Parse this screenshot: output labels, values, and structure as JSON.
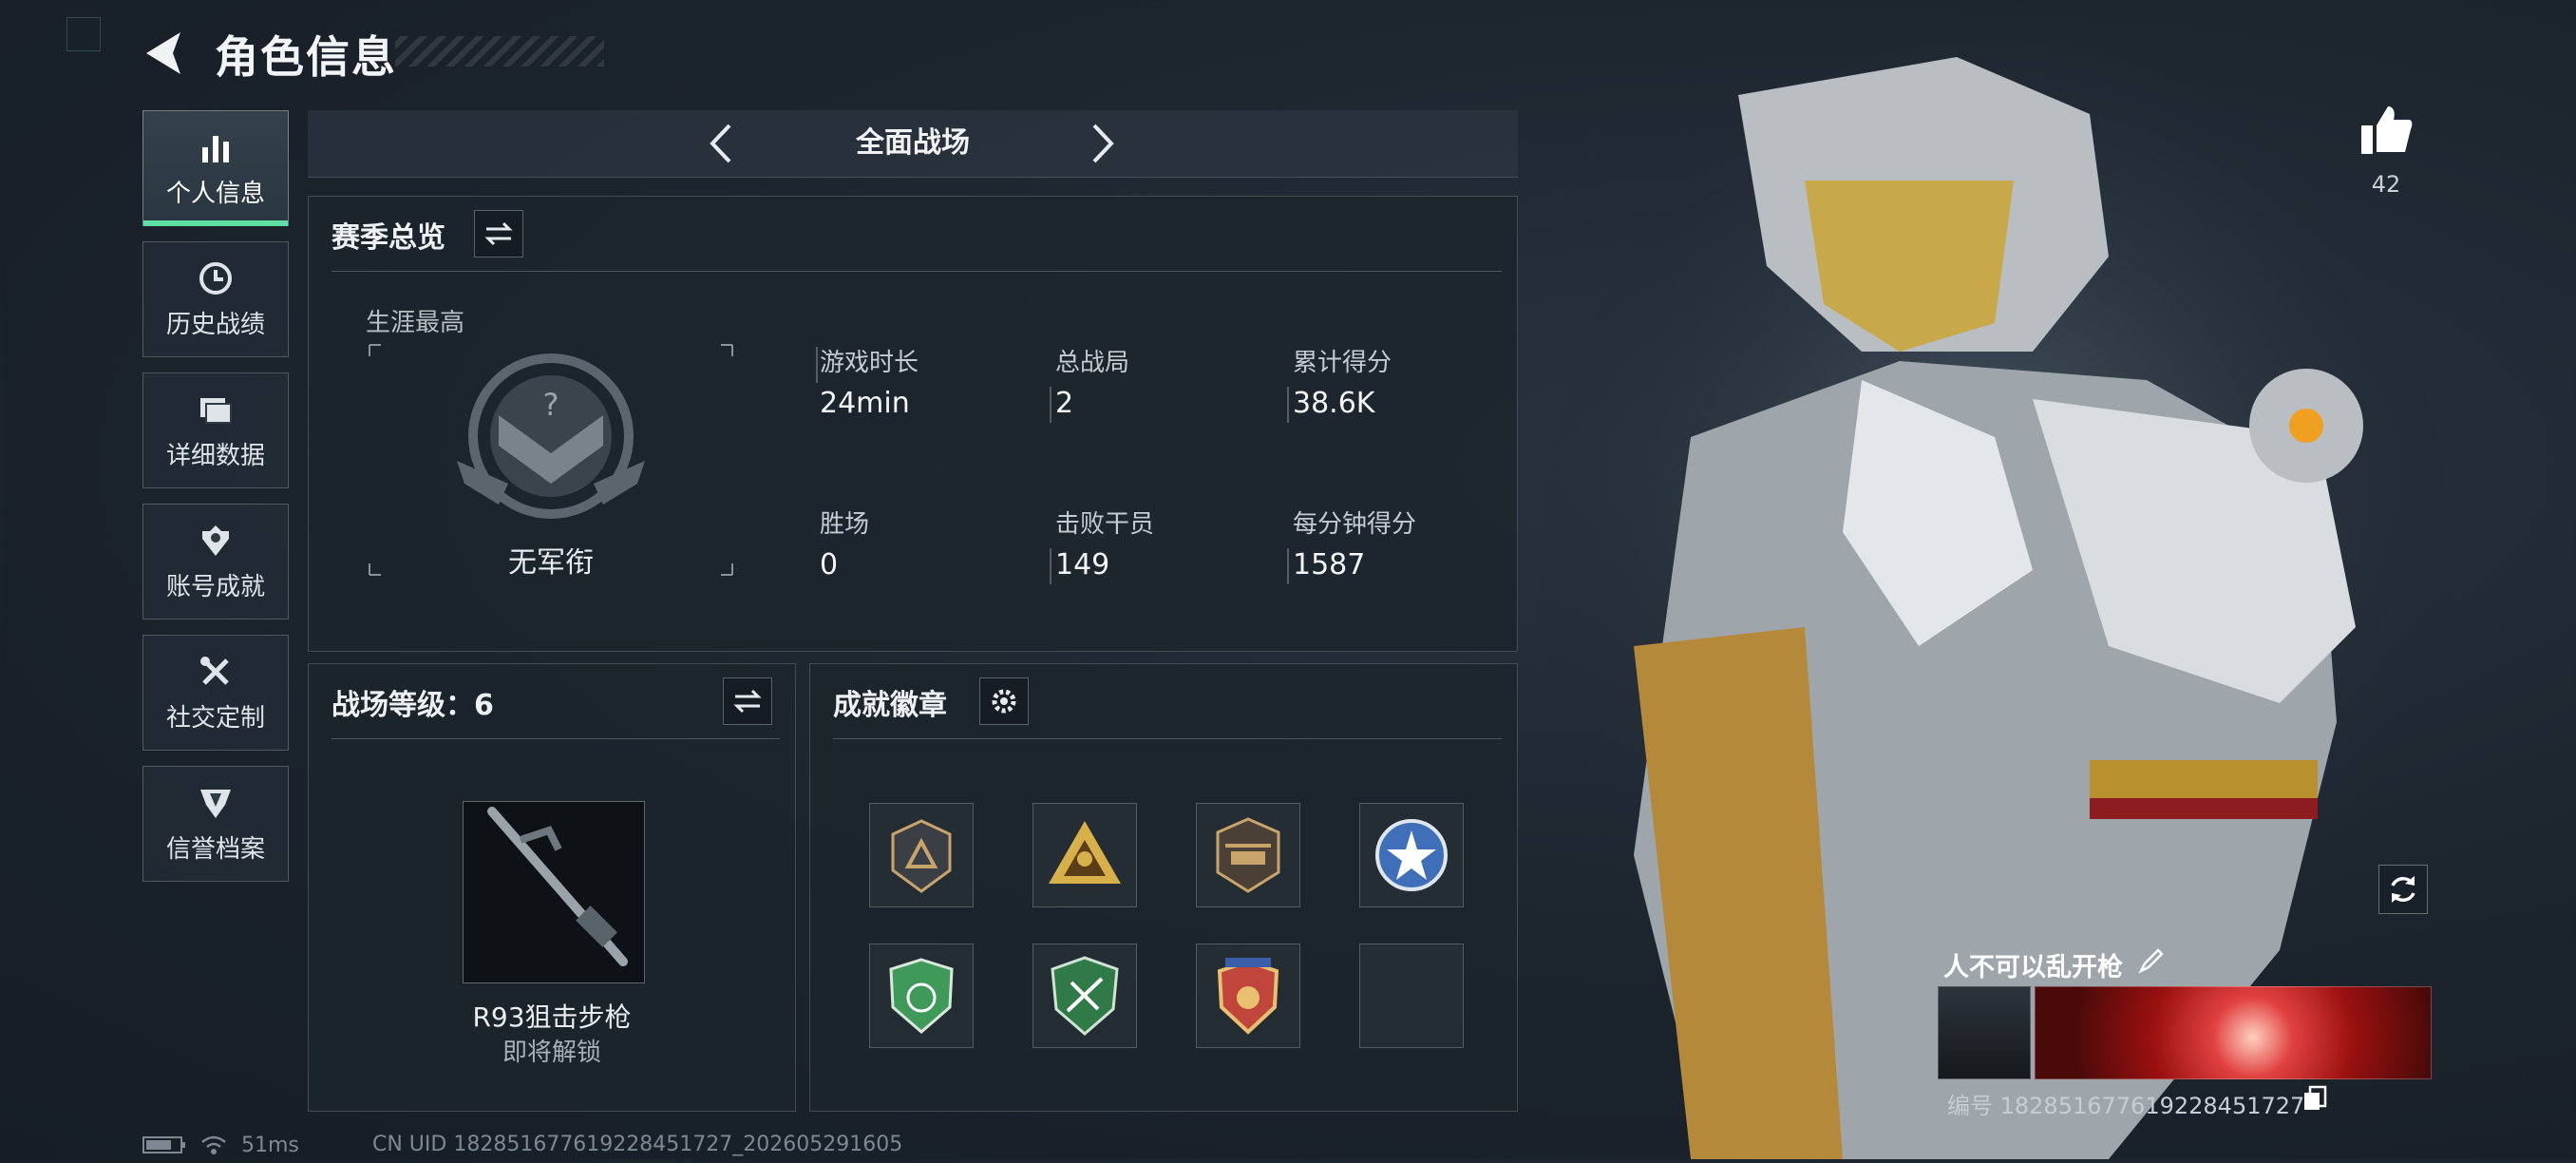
{
  "header": {
    "title": "角色信息"
  },
  "sidebar": {
    "items": [
      {
        "label": "个人信息",
        "icon": "bar-chart-icon",
        "active": true
      },
      {
        "label": "历史战绩",
        "icon": "clock-icon",
        "active": false
      },
      {
        "label": "详细数据",
        "icon": "folder-icon",
        "active": false
      },
      {
        "label": "账号成就",
        "icon": "medal-icon",
        "active": false
      },
      {
        "label": "社交定制",
        "icon": "tools-icon",
        "active": false
      },
      {
        "label": "信誉档案",
        "icon": "shield-badge-icon",
        "active": false
      }
    ]
  },
  "mode_selector": {
    "label": "全面战场"
  },
  "season": {
    "title": "赛季总览",
    "career_label": "生涯最高",
    "rank_name": "无军衔",
    "stats": [
      {
        "label": "游戏时长",
        "value": "24min"
      },
      {
        "label": "总战局",
        "value": "2"
      },
      {
        "label": "累计得分",
        "value": "38.6K"
      },
      {
        "label": "胜场",
        "value": "0"
      },
      {
        "label": "击败干员",
        "value": "149"
      },
      {
        "label": "每分钟得分",
        "value": "1587"
      }
    ]
  },
  "battlefield_level": {
    "title": "战场等级：6",
    "weapon_name": "R93狙击步枪",
    "weapon_status": "即将解锁"
  },
  "achievements": {
    "title": "成就徽章",
    "badges": [
      {
        "icon": "triangle-shield-badge",
        "color": "#c9a46a"
      },
      {
        "icon": "soldiers-triangle-badge",
        "color": "#d8b04a"
      },
      {
        "icon": "helicopter-badge",
        "color": "#c9a46a"
      },
      {
        "icon": "star-circle-badge",
        "color": "#3f6fb8"
      },
      {
        "icon": "green-shield-badge",
        "color": "#3f9a5a"
      },
      {
        "icon": "green-crest-badge",
        "color": "#3f9a5a"
      },
      {
        "icon": "red-crest-badge",
        "color": "#c0453a"
      },
      {
        "icon": "empty-slot",
        "color": ""
      }
    ]
  },
  "profile": {
    "likes": "42",
    "player_name": "人不可以乱开枪",
    "player_id": "编号 1828516776192284517​27"
  },
  "status": {
    "ping": "51ms",
    "uid_line": "CN UID 1828516776192284517​27_202605291605"
  }
}
